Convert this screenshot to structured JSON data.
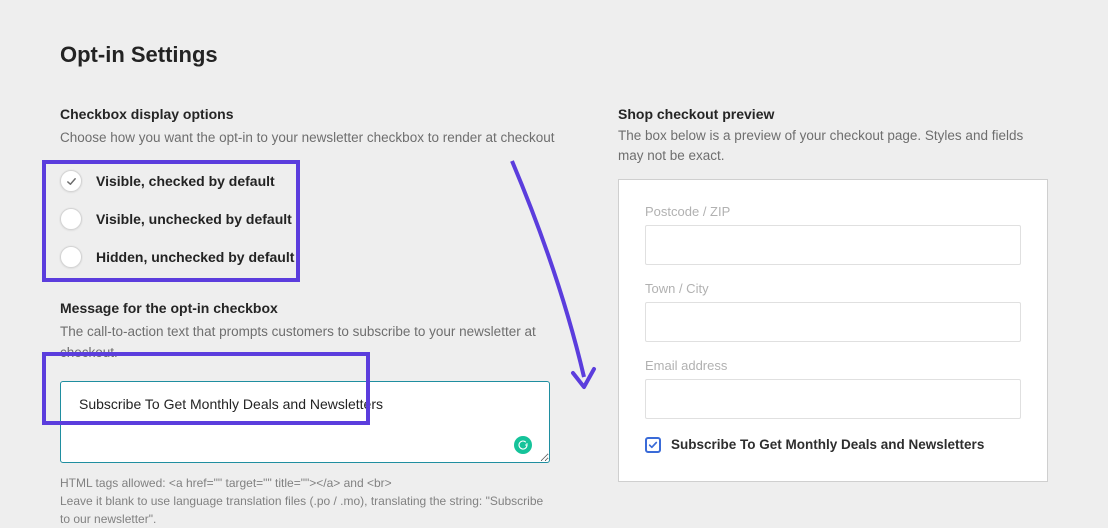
{
  "page_title": "Opt-in Settings",
  "checkbox_options": {
    "title": "Checkbox display options",
    "desc": "Choose how you want the opt-in to your newsletter checkbox to render at checkout",
    "items": [
      {
        "label": "Visible, checked by default",
        "checked": true
      },
      {
        "label": "Visible, unchecked by default",
        "checked": false
      },
      {
        "label": "Hidden, unchecked by default",
        "checked": false
      }
    ]
  },
  "message": {
    "title": "Message for the opt-in checkbox",
    "desc": "The call-to-action text that prompts customers to subscribe to your newsletter at checkout.",
    "value": "Subscribe To Get Monthly Deals and Newsletters",
    "helper": "HTML tags allowed: <a href=\"\" target=\"\" title=\"\"></a> and <br>\nLeave it blank to use language translation files (.po / .mo), translating the string: \"Subscribe to our newsletter\"."
  },
  "preview": {
    "title": "Shop checkout preview",
    "desc": "The box below is a preview of your checkout page. Styles and fields may not be exact.",
    "fields": {
      "postcode": "Postcode / ZIP",
      "town": "Town / City",
      "email": "Email address"
    },
    "checkbox_label": "Subscribe To Get Monthly Deals and Newsletters",
    "checkbox_checked": true
  },
  "annotation_color": "#5b3ddd"
}
